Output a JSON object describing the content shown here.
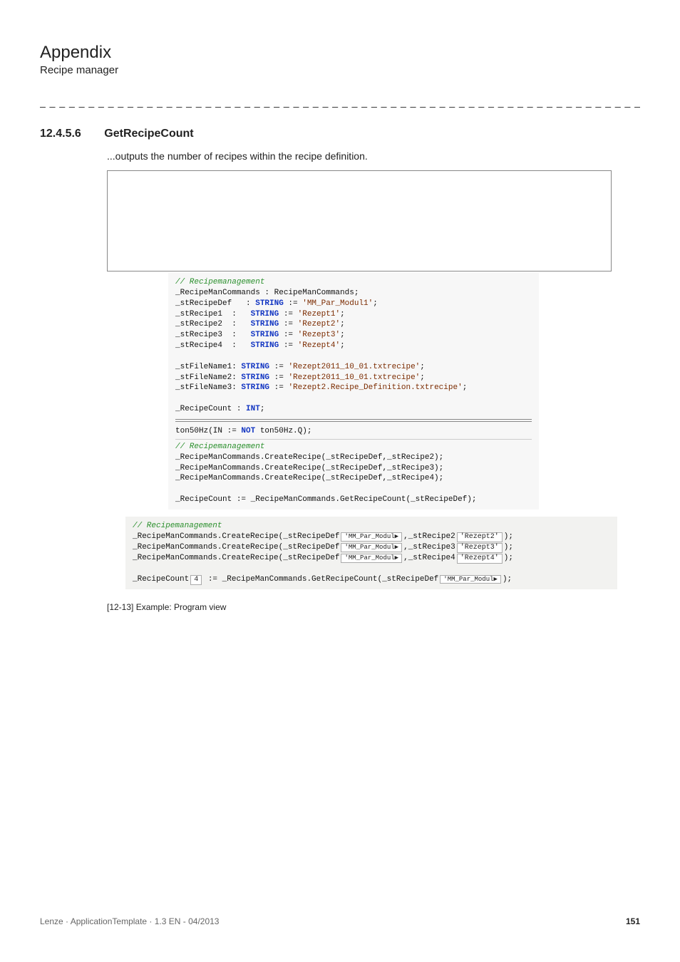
{
  "header": {
    "title": "Appendix",
    "subtitle": "Recipe manager",
    "separator": "_ _ _ _ _ _ _ _ _ _ _ _ _ _ _ _ _ _ _ _ _ _ _ _ _ _ _ _ _ _ _ _ _ _ _ _ _ _ _ _ _ _ _ _ _ _ _ _ _ _ _ _ _ _ _ _ _ _ _ _ _ _ _ _"
  },
  "section": {
    "number": "12.4.5.6",
    "title": "GetRecipeCount",
    "description": "...outputs the number of recipes within the recipe definition."
  },
  "code1": {
    "comment": "// Recipemanagement",
    "l1_a": "_RecipeManCommands : RecipeManCommands;",
    "l2_a": "_stRecipeDef   : ",
    "l2_kw": "STRING",
    "l2_b": " := ",
    "l2_str": "'MM_Par_Modul1'",
    "l2_c": ";",
    "l3_a": "_stRecipe1  :   ",
    "l3_kw": "STRING",
    "l3_b": " := ",
    "l3_str": "'Rezept1'",
    "l3_c": ";",
    "l4_a": "_stRecipe2  :   ",
    "l4_kw": "STRING",
    "l4_b": " := ",
    "l4_str": "'Rezept2'",
    "l4_c": ";",
    "l5_a": "_stRecipe3  :   ",
    "l5_kw": "STRING",
    "l5_b": " := ",
    "l5_str": "'Rezept3'",
    "l5_c": ";",
    "l6_a": "_stRecipe4  :   ",
    "l6_kw": "STRING",
    "l6_b": " := ",
    "l6_str": "'Rezept4'",
    "l6_c": ";",
    "l7_a": "_stFileName1: ",
    "l7_kw": "STRING",
    "l7_b": " := ",
    "l7_str": "'Rezept2011_10_01.txtrecipe'",
    "l7_c": ";",
    "l8_a": "_stFileName2: ",
    "l8_kw": "STRING",
    "l8_b": " := ",
    "l8_str": "'Rezept2011_10_01.txtrecipe'",
    "l8_c": ";",
    "l9_a": "_stFileName3: ",
    "l9_kw": "STRING",
    "l9_b": " := ",
    "l9_str": "'Rezept2.Recipe_Definition.txtrecipe'",
    "l9_c": ";",
    "l10_a": "_RecipeCount : ",
    "l10_kw": "INT",
    "l10_b": ";"
  },
  "code2": {
    "ton_a": "ton50Hz(IN := ",
    "ton_kw": "NOT",
    "ton_b": " ton50Hz.Q);",
    "comment": "// Recipemanagement",
    "cr1": "_RecipeManCommands.CreateRecipe(_stRecipeDef,_stRecipe2);",
    "cr2": "_RecipeManCommands.CreateRecipe(_stRecipeDef,_stRecipe3);",
    "cr3": "_RecipeManCommands.CreateRecipe(_stRecipeDef,_stRecipe4);",
    "cnt": "_RecipeCount := _RecipeManCommands.GetRecipeCount(_stRecipeDef);"
  },
  "runtime": {
    "comment": "// Recipemanagement",
    "r1_a": "_RecipeManCommands.CreateRecipe(_stRecipeDef",
    "r1_v1": "'MM_Par_Modul▶",
    "r1_b": ",_stRecipe2",
    "r1_v2": "'Rezept2'",
    "r1_c": ");",
    "r2_a": "_RecipeManCommands.CreateRecipe(_stRecipeDef",
    "r2_v1": "'MM_Par_Modul▶",
    "r2_b": ",_stRecipe3",
    "r2_v2": "'Rezept3'",
    "r2_c": ");",
    "r3_a": "_RecipeManCommands.CreateRecipe(_stRecipeDef",
    "r3_v1": "'MM_Par_Modul▶",
    "r3_b": ",_stRecipe4",
    "r3_v2": "'Rezept4'",
    "r3_c": ");",
    "r4_a": "_RecipeCount",
    "r4_v1": "4",
    "r4_b": " := _RecipeManCommands.GetRecipeCount(_stRecipeDef",
    "r4_v2": "'MM_Par_Modul▶",
    "r4_c": ");"
  },
  "caption": "[12-13]  Example: Program view",
  "footer": {
    "left": "Lenze · ApplicationTemplate · 1.3 EN - 04/2013",
    "page": "151"
  }
}
